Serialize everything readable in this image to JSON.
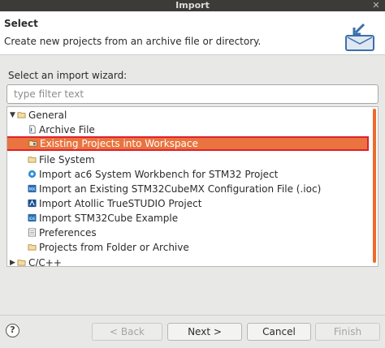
{
  "window": {
    "title": "Import"
  },
  "header": {
    "title": "Select",
    "description": "Create new projects from an archive file or directory."
  },
  "wizard": {
    "label": "Select an import wizard:",
    "filter_placeholder": "type filter text"
  },
  "tree": {
    "items": [
      {
        "label": "General",
        "icon": "folder-open-icon"
      },
      {
        "label": "Archive File",
        "icon": "archive-file-icon"
      },
      {
        "label": "Existing Projects into Workspace",
        "icon": "projects-folder-icon"
      },
      {
        "label": "File System",
        "icon": "folder-icon"
      },
      {
        "label": "Import ac6 System Workbench for STM32 Project",
        "icon": "ac6-icon"
      },
      {
        "label": "Import an Existing STM32CubeMX Configuration File (.ioc)",
        "icon": "cubemx-icon"
      },
      {
        "label": "Import Atollic TrueSTUDIO Project",
        "icon": "atollic-icon"
      },
      {
        "label": "Import STM32Cube Example",
        "icon": "stm32cube-example-icon"
      },
      {
        "label": "Preferences",
        "icon": "preferences-icon"
      },
      {
        "label": "Projects from Folder or Archive",
        "icon": "folder-icon"
      },
      {
        "label": "C/C++",
        "icon": "folder-icon"
      }
    ]
  },
  "buttons": {
    "back": "< Back",
    "next": "Next >",
    "cancel": "Cancel",
    "finish": "Finish"
  },
  "colors": {
    "selection": "#e9743f",
    "selection_outline": "#e0202c",
    "scrollbar": "#f06a2a",
    "titlebar": "#3c3b37"
  }
}
